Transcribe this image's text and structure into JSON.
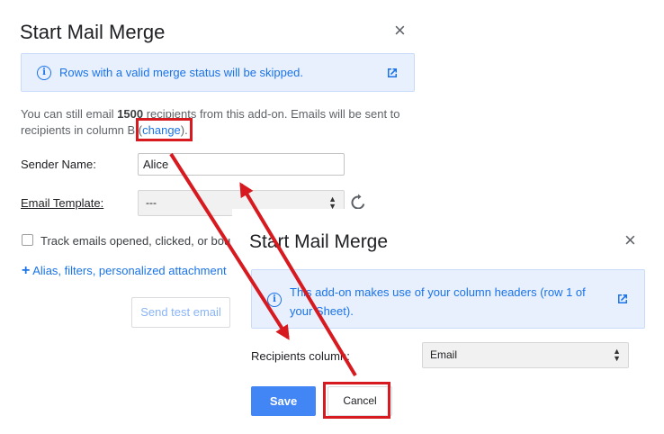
{
  "dialog1": {
    "title": "Start Mail Merge",
    "close_icon": "×",
    "info_text": "Rows with a valid merge status will be skipped.",
    "desc_prefix": "You can still email ",
    "desc_count": "1500",
    "desc_middle": " recipients from this add-on. Emails will be sent to",
    "desc_line2": "recipients in column B (",
    "change_link": "change",
    "desc_suffix": ").",
    "sender_label": "Sender Name:",
    "sender_value": "Alice",
    "template_label": "Email Template:",
    "template_value": "---",
    "track_label": "Track emails opened, clicked, or bou",
    "alias_link": "Alias, filters, personalized attachment",
    "test_button": "Send test email"
  },
  "dialog2": {
    "title": "Start Mail Merge",
    "close_icon": "×",
    "info_line1": "This add-on makes use of your column headers (row 1 of",
    "info_line2": "your Sheet).",
    "recipients_label": "Recipients column:",
    "recipients_value": "Email",
    "save_button": "Save",
    "cancel_button": "Cancel"
  },
  "colors": {
    "accent": "#4285f4",
    "link": "#1a73e8",
    "info_bg": "#e8f0fe",
    "annotation": "#d71a20"
  },
  "icons": [
    "info-icon",
    "open-external-icon",
    "refresh-icon",
    "close-icon",
    "plus-icon",
    "sort-arrows-icon"
  ]
}
